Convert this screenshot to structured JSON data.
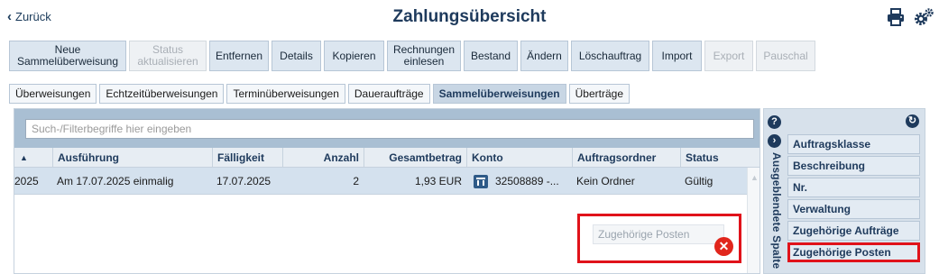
{
  "header": {
    "back_label": "Zurück",
    "title": "Zahlungsübersicht",
    "print_icon": "printer-icon",
    "settings_icon": "gears-icon"
  },
  "toolbar": {
    "buttons": [
      {
        "label": "Neue Sammelüberweisung",
        "line1": "Neue",
        "line2": "Sammelüberweisung",
        "enabled": true
      },
      {
        "label": "Status aktualisieren",
        "line1": "Status",
        "line2": "aktualisieren",
        "enabled": false
      },
      {
        "label": "Entfernen",
        "enabled": true
      },
      {
        "label": "Details",
        "enabled": true
      },
      {
        "label": "Kopieren",
        "enabled": true
      },
      {
        "label": "Rechnungen einlesen",
        "line1": "Rechnungen",
        "line2": "einlesen",
        "enabled": true
      },
      {
        "label": "Bestand",
        "enabled": true
      },
      {
        "label": "Ändern",
        "enabled": true
      },
      {
        "label": "Löschauftrag",
        "enabled": true
      },
      {
        "label": "Import",
        "enabled": true
      },
      {
        "label": "Export",
        "enabled": false
      },
      {
        "label": "Pauschal",
        "enabled": false
      }
    ]
  },
  "tabs": [
    {
      "label": "Überweisungen",
      "active": false
    },
    {
      "label": "Echtzeitüberweisungen",
      "active": false
    },
    {
      "label": "Terminüberweisungen",
      "active": false
    },
    {
      "label": "Daueraufträge",
      "active": false
    },
    {
      "label": "Sammelüberweisungen",
      "active": true
    },
    {
      "label": "Überträge",
      "active": false
    }
  ],
  "search": {
    "placeholder": "Such-/Filterbegriffe hier eingeben",
    "value": ""
  },
  "table": {
    "columns": [
      "Ausführung",
      "Fälligkeit",
      "Anzahl",
      "Gesamtbetrag",
      "Konto",
      "Auftragsordner",
      "Status"
    ],
    "rows": [
      {
        "date_cut": "2025",
        "ausfuehrung": "Am 17.07.2025 einmalig",
        "faelligkeit": "17.07.2025",
        "anzahl": "2",
        "gesamtbetrag": "1,93 EUR",
        "konto": "32508889 -...",
        "konto_icon": "bank-icon",
        "auftragsordner": "Kein Ordner",
        "status": "Gültig"
      }
    ]
  },
  "drop_zone": {
    "label": "Zugehörige Posten",
    "remove_icon": "remove-icon"
  },
  "hidden_columns": {
    "title": "Ausgeblendete Spalten",
    "help_icon": "help-icon",
    "collapse_icon": "collapse-icon",
    "refresh_icon": "refresh-icon",
    "items": [
      {
        "label": "Auftragsklasse",
        "highlighted": false
      },
      {
        "label": "Beschreibung",
        "highlighted": false
      },
      {
        "label": "Nr.",
        "highlighted": false
      },
      {
        "label": "Verwaltung",
        "highlighted": false
      },
      {
        "label": "Zugehörige Aufträge",
        "highlighted": false
      },
      {
        "label": "Zugehörige Posten",
        "highlighted": true
      }
    ]
  },
  "colors": {
    "accent": "#1e3a5c",
    "highlight_red": "#e0121a",
    "selected_row": "#d4e1ee",
    "panel_header": "#a9bfd3"
  }
}
